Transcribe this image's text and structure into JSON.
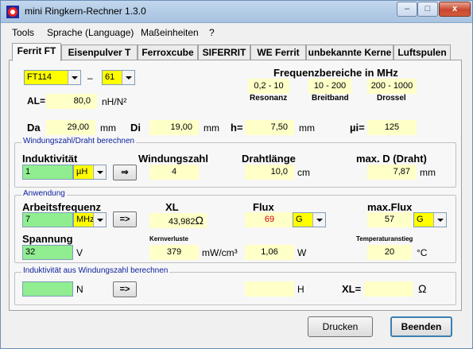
{
  "window": {
    "title": "mini Ringkern-Rechner 1.3.0",
    "min_glyph": "–",
    "max_glyph": "□",
    "close_glyph": "x"
  },
  "menu": [
    "Tools",
    "Sprache (Language)",
    "Maßeinheiten",
    "?"
  ],
  "tabs": [
    "Ferrit FT",
    "Eisenpulver T",
    "Ferroxcube",
    "SIFERRIT",
    "WE Ferrit",
    "unbekannte Kerne",
    "Luftspulen"
  ],
  "core": {
    "type": "FT114",
    "dash": "–",
    "mix": "61",
    "al_label": "AL=",
    "al_value": "80,0",
    "al_unit": "nH/N²"
  },
  "freq": {
    "title": "Frequenzbereiche in MHz",
    "ranges": [
      {
        "value": "0,2 - 10",
        "label": "Resonanz"
      },
      {
        "value": "10 - 200",
        "label": "Breitband"
      },
      {
        "value": "200 - 1000",
        "label": "Drossel"
      }
    ]
  },
  "dims": {
    "da_label": "Da",
    "da_value": "29,00",
    "da_unit": "mm",
    "di_label": "Di",
    "di_value": "19,00",
    "di_unit": "mm",
    "h_label": "h=",
    "h_value": "7,50",
    "h_unit": "mm",
    "mui_label": "µi=",
    "mui_value": "125"
  },
  "winding": {
    "group_title": "Windungszahl/Draht berechnen",
    "ind_label": "Induktivität",
    "ind_value": "1",
    "ind_unit": "µH",
    "calc_btn": "⇒",
    "turns_label": "Windungszahl",
    "turns_value": "4",
    "wire_label": "Drahtlänge",
    "wire_value": "10,0",
    "wire_unit": "cm",
    "maxd_label": "max. D (Draht)",
    "maxd_value": "7,87",
    "maxd_unit": "mm"
  },
  "app": {
    "group_title": "Anwendung",
    "freq_label": "Arbeitsfrequenz",
    "freq_value": "7",
    "freq_unit": "MHz",
    "calc_btn": "=>",
    "xl_label": "XL",
    "xl_value": "43,982",
    "xl_unit": "Ω",
    "flux_label": "Flux",
    "flux_value": "69",
    "flux_unit": "G",
    "maxflux_label": "max.Flux",
    "maxflux_value": "57",
    "maxflux_unit": "G",
    "volt_label": "Spannung",
    "volt_value": "32",
    "volt_unit": "V",
    "loss_label": "Kernverluste",
    "loss_value": "379",
    "loss_unit": "mW/cm³",
    "loss_total_value": "1,06",
    "loss_total_unit": "W",
    "temp_label": "Temperaturanstieg",
    "temp_value": "20",
    "temp_unit": "°C"
  },
  "fromturns": {
    "group_title": "Induktivität aus Windungszahl berechnen",
    "turns_value": "",
    "turns_unit": "N",
    "calc_btn": "=>",
    "ind_value": "",
    "ind_unit": "H",
    "xl_label": "XL=",
    "xl_value": "",
    "xl_unit": "Ω"
  },
  "footer": {
    "print_btn": "Drucken",
    "exit_btn": "Beenden"
  }
}
